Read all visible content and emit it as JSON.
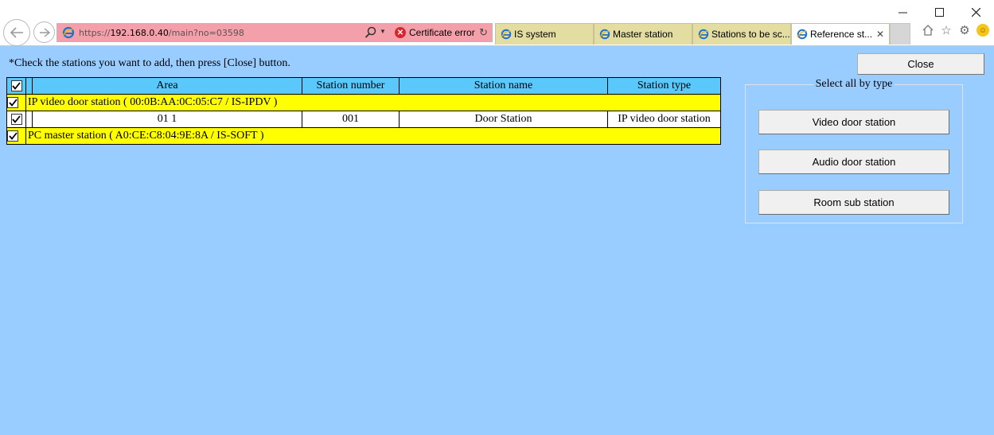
{
  "browser": {
    "url_prefix": "https://",
    "url_host": "192.168.0.40",
    "url_path": "/main?no=03598",
    "certificate_error_label": "Certificate error",
    "tabs": [
      {
        "label": "IS system",
        "active": false
      },
      {
        "label": "Master station",
        "active": false
      },
      {
        "label": "Stations to be sc...",
        "active": false
      },
      {
        "label": "Reference st...",
        "active": true
      }
    ],
    "icons": [
      "back-arrow-icon",
      "forward-arrow-icon",
      "ie-icon",
      "search-icon",
      "refresh-icon",
      "home-icon",
      "favorites-star-icon",
      "settings-gear-icon",
      "smiley-feedback-icon",
      "minimize-icon",
      "maximize-icon",
      "close-window-icon"
    ],
    "colors": {
      "address_bar_error": "#f4a0ab",
      "tab_inactive": "#e3dda2"
    }
  },
  "page": {
    "instruction": "*Check the stations you want to add, then press [Close] button.",
    "close_label": "Close",
    "background_color": "#99ccff"
  },
  "table": {
    "header_checked": true,
    "headers": {
      "area": "Area",
      "station_number": "Station number",
      "station_name": "Station name",
      "station_type": "Station type"
    },
    "groups": [
      {
        "label": "IP video door station ( 00:0B:AA:0C:05:C7 / IS-IPDV )",
        "checked": true,
        "rows": [
          {
            "checked": true,
            "area": "01 1",
            "station_number": "001",
            "station_name": "Door Station",
            "station_type": "IP video door station"
          }
        ]
      },
      {
        "label": "PC master station ( A0:CE:C8:04:9E:8A / IS-SOFT )",
        "checked": true,
        "rows": []
      }
    ],
    "colors": {
      "header": "#5ac8fa",
      "group_row": "#ffff00",
      "data_row": "#ffffff"
    }
  },
  "select_all": {
    "legend": "Select all by type",
    "buttons": [
      "Video door station",
      "Audio door station",
      "Room sub station"
    ]
  }
}
